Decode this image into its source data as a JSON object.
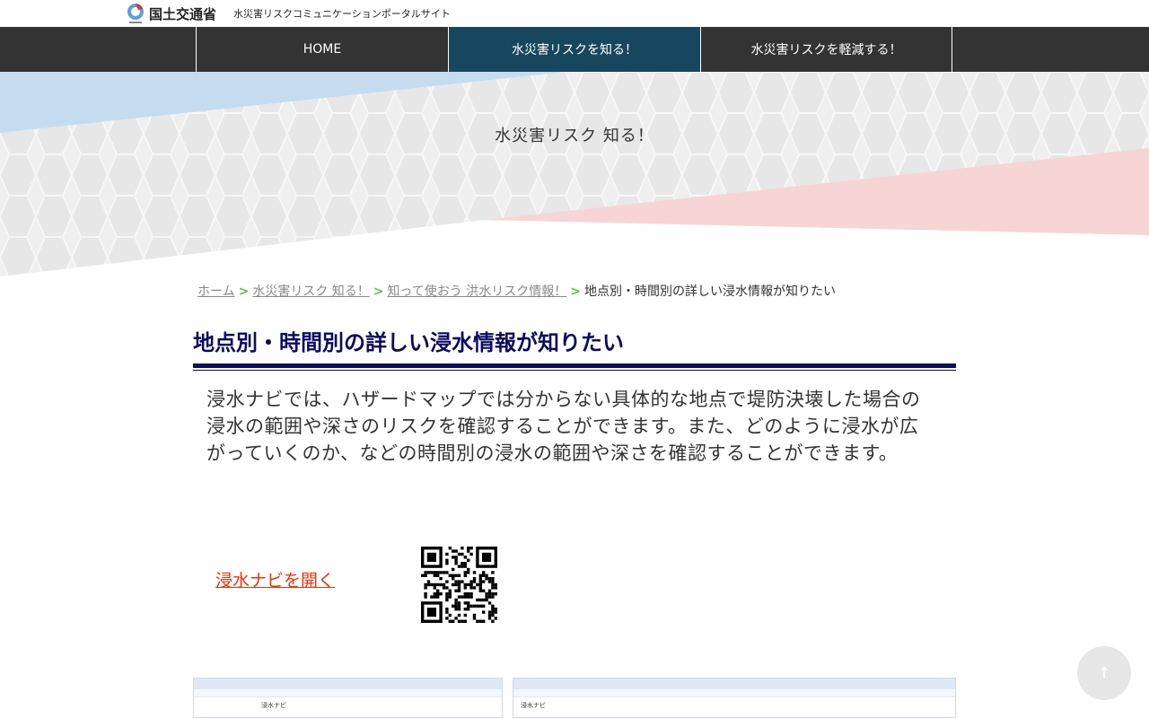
{
  "header": {
    "logo_text": "国土交通省",
    "site_name": "水災害リスクコミュニケーションポータルサイト"
  },
  "nav": [
    {
      "label": "HOME"
    },
    {
      "label": "水災害リスクを知る！"
    },
    {
      "label": "水災害リスクを軽減する！"
    }
  ],
  "banner": {
    "title": "水災害リスク 知る！"
  },
  "breadcrumb": {
    "items": [
      "ホーム",
      "水災害リスク 知る！",
      "知って使おう 洪水リスク情報！"
    ],
    "current": "地点別・時間別の詳しい浸水情報が知りたい",
    "separator": ">"
  },
  "page": {
    "title": "地点別・時間別の詳しい浸水情報が知りたい",
    "description": "浸水ナビでは、ハザードマップでは分からない具体的な地点で堤防決壊した場合の浸水の範囲や深さのリスクを確認することができます。また、どのように浸水が広がっていくのか、などの時間別の浸水の範囲や深さを確認することができます。",
    "open_link": "浸水ナビを開く"
  },
  "screenshots": [
    {
      "caption": "浸水ナビ"
    },
    {
      "caption": "浸水ナビ"
    }
  ],
  "scroll_top": "↑",
  "colors": {
    "nav_bg": "#333333",
    "nav_active": "#17475e",
    "title": "#0b0b5e",
    "link": "#e8340c",
    "crumb_sep": "#5fc04a"
  }
}
